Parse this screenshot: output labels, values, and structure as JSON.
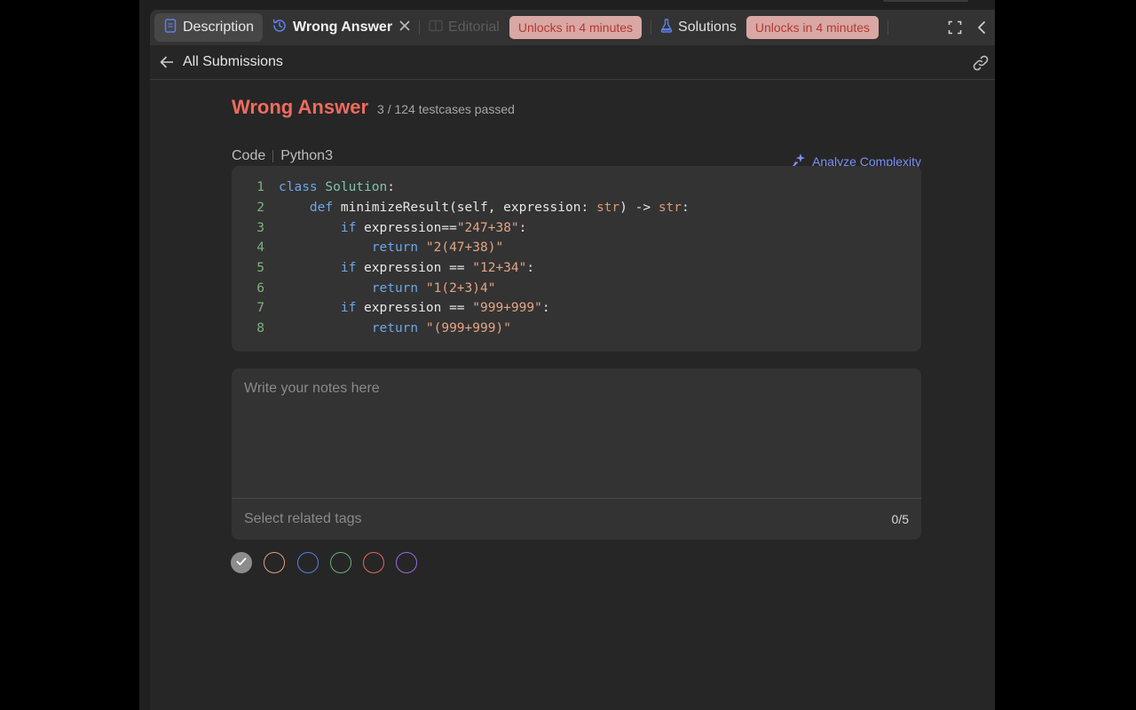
{
  "tabs": {
    "description": "Description",
    "wrong_answer": "Wrong Answer",
    "editorial": "Editorial",
    "editorial_badge": "Unlocks in 4 minutes",
    "solutions": "Solutions",
    "solutions_badge": "Unlocks in 4 minutes"
  },
  "header": {
    "back_label": "All Submissions"
  },
  "result": {
    "status": "Wrong Answer",
    "testcases": "3 / 124 testcases passed"
  },
  "code": {
    "label": "Code",
    "language": "Python3",
    "analyze_label": "Analyze Complexity",
    "lines": [
      {
        "n": "1"
      },
      {
        "n": "2"
      },
      {
        "n": "3"
      },
      {
        "n": "4"
      },
      {
        "n": "5"
      },
      {
        "n": "6"
      },
      {
        "n": "7"
      },
      {
        "n": "8"
      }
    ],
    "tokens": {
      "l1_kw": "class",
      "l1_cls": "Solution",
      "l1_rest": ":",
      "l2_kw": "def",
      "l2_mid": "minimizeResult(self, expression: ",
      "l2_t1": "str",
      "l2_arrow": ") -> ",
      "l2_t2": "str",
      "l2_end": ":",
      "l3_kw": "if",
      "l3_mid": "expression==",
      "l3_str": "\"247+38\"",
      "l3_end": ":",
      "l4_kw": "return",
      "l4_str": "\"2(47+38)\"",
      "l5_kw": "if",
      "l5_mid": "expression == ",
      "l5_str": "\"12+34\"",
      "l5_end": ":",
      "l6_kw": "return",
      "l6_str": "\"1(2+3)4\"",
      "l7_kw": "if",
      "l7_mid": "expression == ",
      "l7_str": "\"999+999\"",
      "l7_end": ":",
      "l8_kw": "return",
      "l8_str": "\"(999+999)\""
    }
  },
  "notes": {
    "placeholder": "Write your notes here",
    "tags_placeholder": "Select related tags",
    "tags_count": "0/5"
  },
  "colors": {
    "accent_red": "#ef6b5f",
    "accent_blue": "#7a90f5",
    "tag_colors": [
      "#8c8c8c",
      "#e0a07e",
      "#5b7fe6",
      "#6fb07a",
      "#e06a60",
      "#9b6be6"
    ]
  }
}
